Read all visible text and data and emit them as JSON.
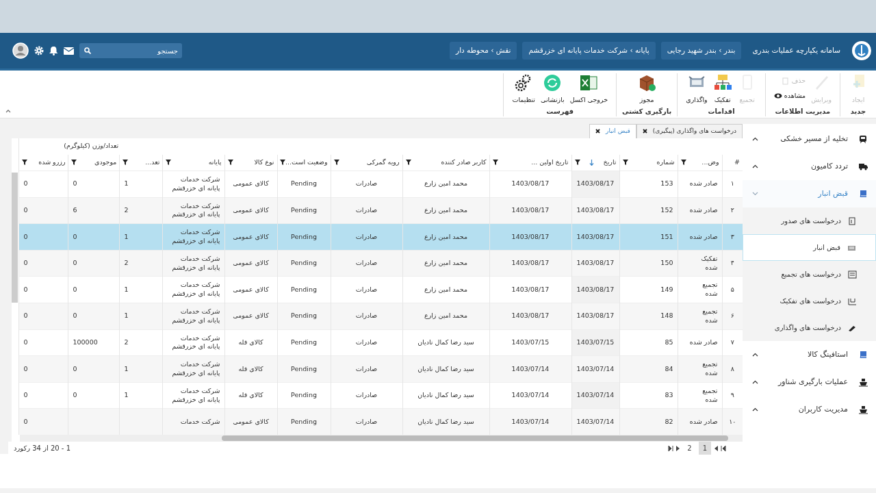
{
  "header": {
    "title": "سامانه یکپارچه عملیات بندری",
    "breadcrumbs": [
      {
        "text": "بندر › بندر شهید رجایی"
      },
      {
        "text": "پایانه › شرکت خدمات پایانه ای خزرقشم"
      },
      {
        "text": "نقش › محوطه دار"
      }
    ],
    "search": {
      "placeholder": "جستجو"
    }
  },
  "toolbar": [
    {
      "label": "جدید",
      "buttons": [
        {
          "label": "ایجاد",
          "kind": "new",
          "disabled": true
        }
      ]
    },
    {
      "label": "مدیریت اطلاعات",
      "buttons": [
        {
          "label": "ویرایش",
          "kind": "edit",
          "disabled": true
        },
        {
          "label": "حذف",
          "kind": "delete",
          "disabled": true
        },
        {
          "label": "مشاهده",
          "kind": "view",
          "disabled": false
        }
      ]
    },
    {
      "label": "اقدامات",
      "buttons": [
        {
          "label": "تجمیع",
          "kind": "merge",
          "disabled": true
        },
        {
          "label": "تفکیک",
          "kind": "split",
          "disabled": false
        },
        {
          "label": "واگذاری",
          "kind": "assign",
          "disabled": false
        }
      ]
    },
    {
      "label": "بارگیری کشتی",
      "buttons": [
        {
          "label": "مجوز",
          "kind": "permit",
          "disabled": false
        }
      ]
    },
    {
      "label": "فهرست",
      "buttons": [
        {
          "label": "خروجی اکسل",
          "kind": "excel",
          "disabled": false
        },
        {
          "label": "بازنشانی",
          "kind": "reset",
          "disabled": false
        },
        {
          "label": "تنظیمات",
          "kind": "settings",
          "disabled": false
        }
      ]
    }
  ],
  "tabs": [
    {
      "label": "درخواست های واگذاری (پیگیری)",
      "selected": false
    },
    {
      "label": "قبض انبار",
      "selected": true
    }
  ],
  "table": {
    "group_header": "تعداد/وزن (کیلوگرم)",
    "columns": [
      {
        "label": "#",
        "filter": false,
        "sorted": false
      },
      {
        "label": "وض...",
        "filter": true,
        "sorted": false
      },
      {
        "label": "شماره",
        "filter": true,
        "sorted": false
      },
      {
        "label": "تاریخ",
        "filter": true,
        "sorted": true
      },
      {
        "label": "تاریخ اولین ...",
        "filter": true,
        "sorted": false
      },
      {
        "label": "کاربر صادر کننده",
        "filter": true,
        "sorted": false
      },
      {
        "label": "رویه گمرکی",
        "filter": true,
        "sorted": false
      },
      {
        "label": "وضعیت است...",
        "filter": true,
        "sorted": false
      },
      {
        "label": "نوع کالا",
        "filter": true,
        "sorted": false
      },
      {
        "label": "پایانه",
        "filter": true,
        "sorted": false
      },
      {
        "label": "تعد...",
        "filter": true,
        "sorted": false
      },
      {
        "label": "موجودی",
        "filter": true,
        "sorted": false
      },
      {
        "label": "رزرو شده",
        "filter": true,
        "sorted": false
      }
    ],
    "rows": [
      {
        "selected": false,
        "cells": [
          "۱",
          "صادر شده",
          "153",
          "1403/08/17",
          "1403/08/17",
          "محمد امین زارع",
          "صادرات",
          "Pending",
          "کالای عمومی",
          "شرکت خدمات\nپایانه ای خزرقشم",
          "1",
          "0",
          "0"
        ]
      },
      {
        "selected": false,
        "cells": [
          "۲",
          "صادر شده",
          "152",
          "1403/08/17",
          "1403/08/17",
          "محمد امین زارع",
          "صادرات",
          "Pending",
          "کالای عمومی",
          "شرکت خدمات\nپایانه ای خزرقشم",
          "2",
          "6",
          "0"
        ]
      },
      {
        "selected": true,
        "cells": [
          "۳",
          "صادر شده",
          "151",
          "1403/08/17",
          "1403/08/17",
          "محمد امین زارع",
          "صادرات",
          "Pending",
          "کالای عمومی",
          "شرکت خدمات\nپایانه ای خزرقشم",
          "1",
          "0",
          "0"
        ]
      },
      {
        "selected": false,
        "cells": [
          "۴",
          "تفکیک\nشده",
          "150",
          "1403/08/17",
          "1403/08/17",
          "محمد امین زارع",
          "صادرات",
          "Pending",
          "کالای عمومی",
          "شرکت خدمات\nپایانه ای خزرقشم",
          "2",
          "0",
          "0"
        ]
      },
      {
        "selected": false,
        "cells": [
          "۵",
          "تجمیع\nشده",
          "149",
          "1403/08/17",
          "1403/08/17",
          "محمد امین زارع",
          "صادرات",
          "Pending",
          "کالای عمومی",
          "شرکت خدمات\nپایانه ای خزرقشم",
          "1",
          "0",
          "0"
        ]
      },
      {
        "selected": false,
        "cells": [
          "۶",
          "تجمیع\nشده",
          "148",
          "1403/08/17",
          "1403/08/17",
          "محمد امین زارع",
          "صادرات",
          "Pending",
          "کالای عمومی",
          "شرکت خدمات\nپایانه ای خزرقشم",
          "1",
          "0",
          "0"
        ]
      },
      {
        "selected": false,
        "cells": [
          "۷",
          "صادر شده",
          "85",
          "1403/07/15",
          "1403/07/15",
          "سید رضا کمال نادیان",
          "صادرات",
          "Pending",
          "کالای فله",
          "شرکت خدمات\nپایانه ای خزرقشم",
          "2",
          "100000",
          "0"
        ]
      },
      {
        "selected": false,
        "cells": [
          "۸",
          "تجمیع\nشده",
          "84",
          "1403/07/14",
          "1403/07/14",
          "سید رضا کمال نادیان",
          "صادرات",
          "Pending",
          "کالای فله",
          "شرکت خدمات\nپایانه ای خزرقشم",
          "1",
          "0",
          "0"
        ]
      },
      {
        "selected": false,
        "cells": [
          "۹",
          "تجمیع\nشده",
          "83",
          "1403/07/14",
          "1403/07/14",
          "سید رضا کمال نادیان",
          "صادرات",
          "Pending",
          "کالای فله",
          "شرکت خدمات\nپایانه ای خزرقشم",
          "1",
          "0",
          "0"
        ]
      },
      {
        "selected": false,
        "cells": [
          "۱۰",
          "صادر شده",
          "82",
          "1403/07/14",
          "1403/07/14",
          "سید رضا کمال نادیان",
          "صادرات",
          "Pending",
          "کالای عمومی",
          "شرکت خدمات",
          "",
          "",
          "0"
        ]
      }
    ]
  },
  "pagination": {
    "pages": [
      {
        "label": "1",
        "selected": true
      },
      {
        "label": "2",
        "selected": false
      }
    ],
    "summary": "1 - 20 از 34 رکورد"
  },
  "sidebar": [
    {
      "label": "تخلیه از مسیر خشکی",
      "kind": "train",
      "expanded": false
    },
    {
      "label": "تردد کامیون",
      "kind": "truck",
      "expanded": false
    },
    {
      "label": "قبض انبار",
      "kind": "book",
      "expanded": true,
      "children": [
        {
          "label": "درخواست های صدور",
          "kind": "doc",
          "selected": false
        },
        {
          "label": "قبض انبار",
          "kind": "card",
          "selected": true
        },
        {
          "label": "درخواست های تجمیع",
          "kind": "merge",
          "selected": false
        },
        {
          "label": "درخواست های تفکیک",
          "kind": "split",
          "selected": false
        },
        {
          "label": "درخواست های واگذاری",
          "kind": "pen",
          "selected": false
        }
      ]
    },
    {
      "label": "استافینگ کالا",
      "kind": "book",
      "expanded": false
    },
    {
      "label": "عملیات بارگیری شناور",
      "kind": "ship",
      "expanded": false
    },
    {
      "label": "مدیریت کاربران",
      "kind": "ship",
      "expanded": false
    }
  ]
}
